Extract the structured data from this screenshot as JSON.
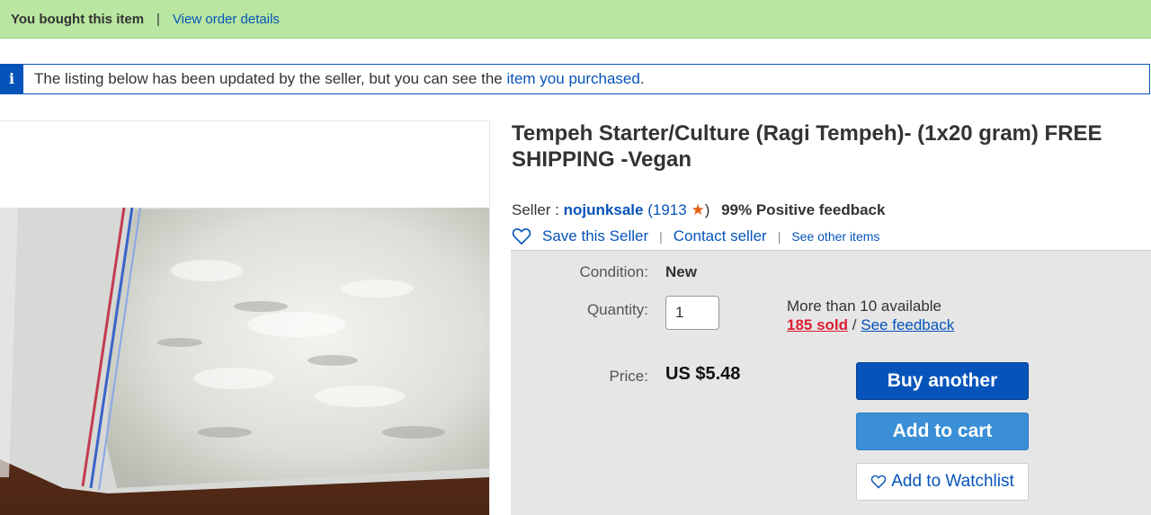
{
  "purchase_banner": {
    "status": "You bought this item",
    "separator": "|",
    "order_link": "View order details"
  },
  "notice": {
    "icon": "info-icon",
    "icon_glyph": "i",
    "text_before": "The listing below has been updated by the seller, but you can see the ",
    "link": "item you purchased",
    "text_after": "."
  },
  "listing": {
    "title": "Tempeh Starter/Culture (Ragi Tempeh)- (1x20 gram) FREE SHIPPING -Vegan",
    "image": "tempeh-starter-bag-photo"
  },
  "seller": {
    "label": "Seller :",
    "name": "nojunksale",
    "feedback_open": "(",
    "feedback_score": "1913",
    "star_icon": "feedback-star-icon",
    "feedback_close": ")",
    "positive": "99% Positive feedback",
    "save_seller": "Save this Seller",
    "separator": "|",
    "contact": "Contact seller",
    "other_items": "See other items"
  },
  "buy_box": {
    "condition_label": "Condition:",
    "condition_value": "New",
    "quantity_label": "Quantity:",
    "quantity_value": "1",
    "available": "More than 10 available",
    "sold": "185 sold",
    "slash": "/",
    "see_feedback": "See feedback",
    "price_label": "Price:",
    "price_value": "US $5.48",
    "buy_another": "Buy another",
    "add_to_cart": "Add to cart",
    "add_to_watchlist": "Add to Watchlist"
  },
  "colors": {
    "banner_green": "#b9e6a0",
    "link_blue": "#0654ba",
    "buy_button": "#0654ba",
    "cart_button": "#3a8fd6",
    "sold_red": "#dd1e31",
    "box_grey": "#e6e6e6"
  }
}
